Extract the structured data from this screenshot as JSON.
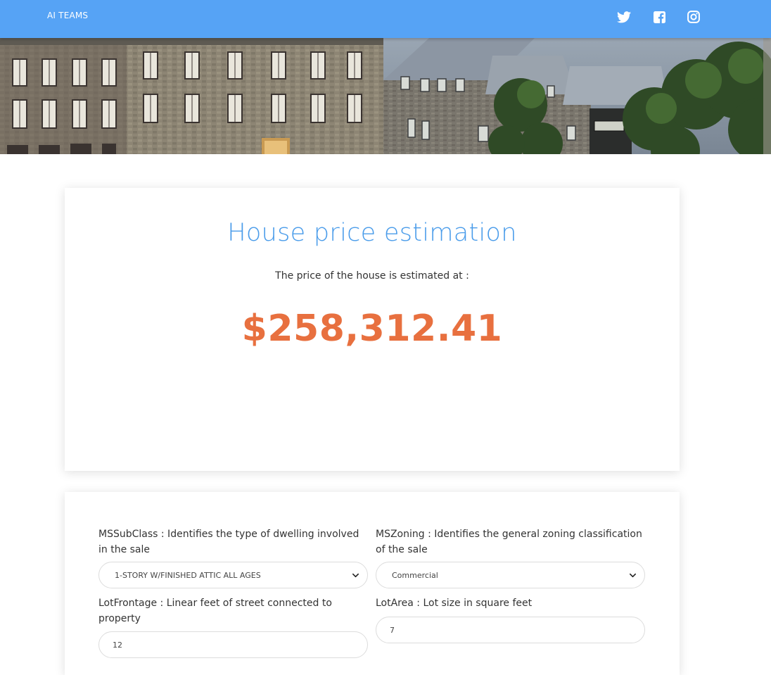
{
  "nav": {
    "brand": "AI TEAMS",
    "social": [
      {
        "name": "twitter-icon"
      },
      {
        "name": "facebook-icon"
      },
      {
        "name": "instagram-icon"
      }
    ]
  },
  "result": {
    "title": "House price estimation",
    "subtitle": "The price of the house is estimated at :",
    "price": "$258,312.41"
  },
  "form": {
    "mssubclass": {
      "label": "MSSubClass : Identifies the type of dwelling involved in the sale",
      "value": "1-STORY W/FINISHED ATTIC ALL AGES"
    },
    "mszoning": {
      "label": "MSZoning : Identifies the general zoning classification of the sale",
      "value": "Commercial"
    },
    "lotfrontage": {
      "label": "LotFrontage : Linear feet of street connected to property",
      "value": "12"
    },
    "lotarea": {
      "label": "LotArea : Lot size in square feet",
      "value": "7"
    }
  },
  "colors": {
    "nav_bg": "#56a3f5",
    "title": "#4a9cea",
    "price": "#e8703f"
  }
}
